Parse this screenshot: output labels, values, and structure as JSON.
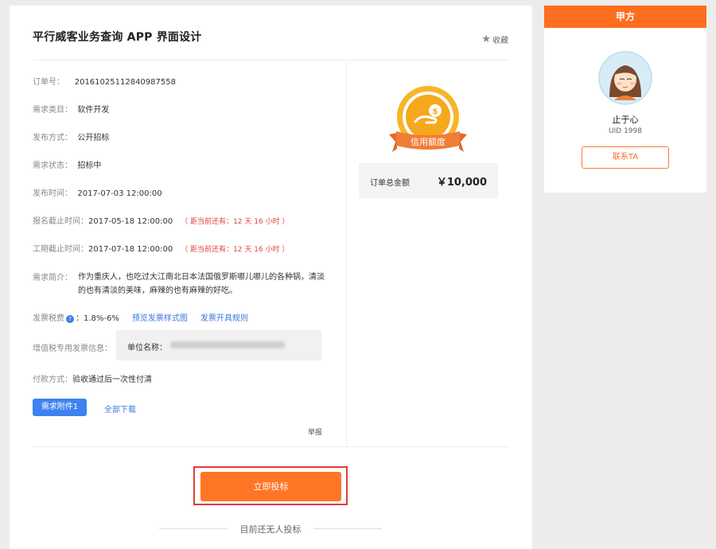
{
  "title": "平行威客业务查询 APP 界面设计",
  "favorite_label": "收藏",
  "fields": {
    "order_no": {
      "label": "订单号：",
      "value": "20161025112840987558"
    },
    "category": {
      "label": "需求类目：",
      "value": "软件开发"
    },
    "publish_method": {
      "label": "发布方式：",
      "value": "公开招标"
    },
    "status": {
      "label": "需求状态：",
      "value": "招标中"
    },
    "publish_time": {
      "label": "发布时间：",
      "value": "2017-07-03 12:00:00"
    },
    "signup_deadline": {
      "label": "报名截止时间：",
      "value": "2017-05-18 12:00:00",
      "remaining": "（ 距当前还有：12 天 16 小时 ）"
    },
    "period_deadline": {
      "label": "工期截止时间：",
      "value": "2017-07-18 12:00:00",
      "remaining": "（ 距当前还有：12 天 16 小时 ）"
    },
    "intro": {
      "label": "需求简介：",
      "value": "作为重庆人，也吃过大江南北日本法国俄罗斯哪儿哪儿的各种锅，清淡的也有清淡的美味，麻辣的也有麻辣的好吃。"
    },
    "tax": {
      "label": "发票税费",
      "value": "：1.8%-6%",
      "link_preview": "预览发票样式图",
      "link_rules": "发票开具规则"
    },
    "vat_invoice": {
      "label": "增值税专用发票信息：",
      "company_label": "单位名称："
    },
    "payment": {
      "label": "付款方式：",
      "value": "验收通过后一次性付清"
    }
  },
  "attachment_button": "需求附件1",
  "download_all": "全部下载",
  "report": "举报",
  "credit_badge": "信用额度",
  "amount": {
    "label": "订单总金额",
    "value": "￥10,000"
  },
  "bid_button": "立即投标",
  "no_bids": "目前还无人投标",
  "sidebar": {
    "header": "甲方",
    "username": "止于心",
    "uid": "UID 1998",
    "contact_button": "联系TA"
  },
  "colors": {
    "accent": "#ff6d1e",
    "link": "#3b7ad9",
    "warning": "#e0473b",
    "badge_gold": "#f5a81c"
  }
}
